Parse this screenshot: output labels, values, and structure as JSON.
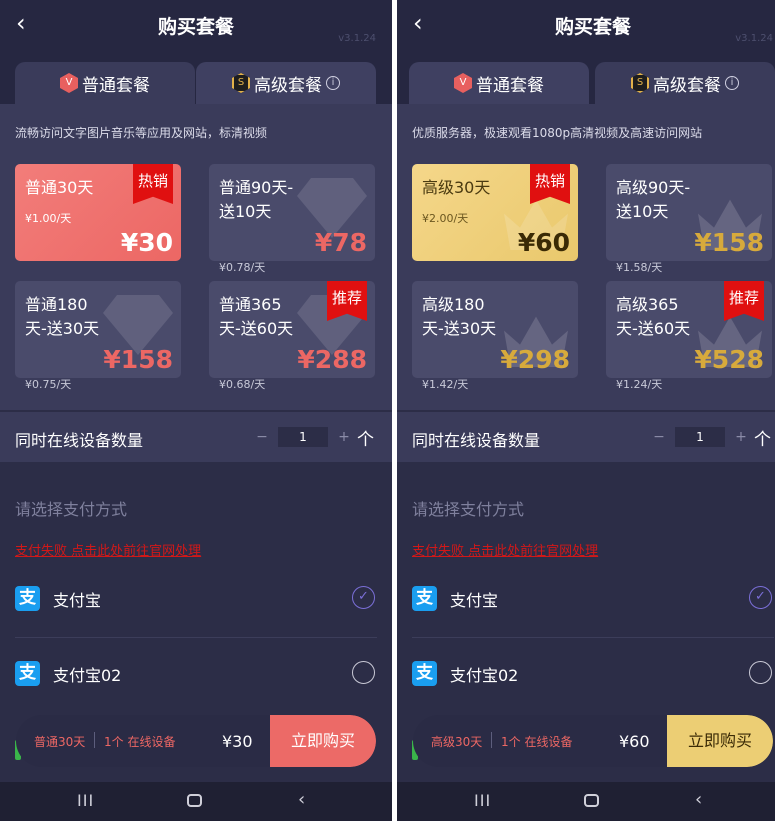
{
  "header": {
    "back_icon": "‹",
    "title": "购买套餐",
    "version": "v3.1.24"
  },
  "tabs": [
    {
      "label": "普通套餐",
      "badge": "V"
    },
    {
      "label": "高级套餐",
      "badge": "S",
      "info": "i"
    }
  ],
  "panels": [
    {
      "active_tab": 0,
      "description": "流畅访问文字图片音乐等应用及网站，标清视频",
      "accent": "#ec6764",
      "plans": [
        {
          "name": "普通30天",
          "unit_price": "¥1.00/天",
          "price": "¥30",
          "ribbon": "热销"
        },
        {
          "name": "普通90天-送10天",
          "unit_price": "¥0.78/天",
          "price": "¥78"
        },
        {
          "name": "普通180天-送30天",
          "unit_price": "¥0.75/天",
          "price": "¥158"
        },
        {
          "name": "普通365天-送60天",
          "unit_price": "¥0.68/天",
          "price": "¥288",
          "ribbon": "推荐"
        }
      ],
      "summary": {
        "plan": "普通30天",
        "devices": "1个 在线设备",
        "price": "¥30",
        "buy_label": "立即购买"
      }
    },
    {
      "active_tab": 1,
      "description": "优质服务器，极速观看1080p高清视频及高速访问网站",
      "accent": "#d7aa3c",
      "plans": [
        {
          "name": "高级30天",
          "unit_price": "¥2.00/天",
          "price": "¥60",
          "ribbon": "热销"
        },
        {
          "name": "高级90天-送10天",
          "unit_price": "¥1.58/天",
          "price": "¥158"
        },
        {
          "name": "高级180天-送30天",
          "unit_price": "¥1.42/天",
          "price": "¥298"
        },
        {
          "name": "高级365天-送60天",
          "unit_price": "¥1.24/天",
          "price": "¥528",
          "ribbon": "推荐"
        }
      ],
      "summary": {
        "plan": "高级30天",
        "devices": "1个 在线设备",
        "price": "¥60",
        "buy_label": "立即购买"
      }
    }
  ],
  "devices": {
    "label": "同时在线设备数量",
    "minus": "−",
    "value": "1",
    "plus": "+",
    "unit": "个"
  },
  "payment": {
    "title": "请选择支付方式",
    "link": "支付失败 点击此处前往官网处理",
    "methods": [
      {
        "name": "支付宝",
        "icon": "支",
        "selected": true,
        "check": "✓"
      },
      {
        "name": "支付宝02",
        "icon": "支",
        "selected": false
      }
    ]
  },
  "nav": {
    "recent": "III",
    "back": "‹"
  },
  "colors": {
    "background": "#2c2d47",
    "card": "#4a4b6b",
    "normal_hot": "#ec6764",
    "premium_hot": "#e9c86c",
    "gold_price": "#d7aa3c",
    "ribbon": "#e01010"
  }
}
